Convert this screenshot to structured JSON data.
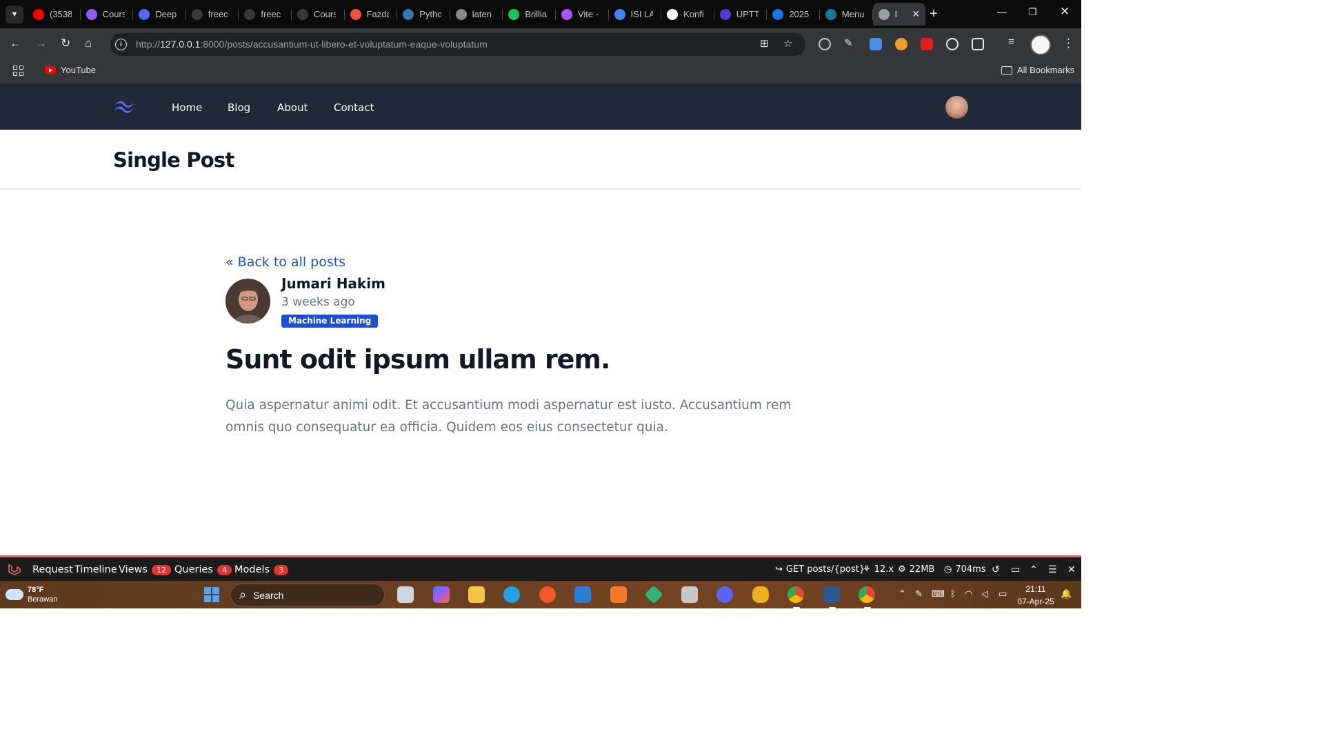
{
  "browser": {
    "tabs": [
      {
        "title": "(3538",
        "icon": "youtube-icon",
        "color": "#ff0000"
      },
      {
        "title": "Cours",
        "icon": "course-icon",
        "color": "#8b5cf6"
      },
      {
        "title": "Deep",
        "icon": "deepseek-icon",
        "color": "#4d6bfe"
      },
      {
        "title": "freec",
        "icon": "freecodecamp-icon",
        "color": "#3a3a3a"
      },
      {
        "title": "freec",
        "icon": "freecodecamp-icon",
        "color": "#3a3a3a"
      },
      {
        "title": "Cours",
        "icon": "course-icon",
        "color": "#3a3a3a"
      },
      {
        "title": "Fazda",
        "icon": "laravel-icon",
        "color": "#f05340"
      },
      {
        "title": "Pytho",
        "icon": "python-icon",
        "color": "#3776ab"
      },
      {
        "title": "laten",
        "icon": "globe-icon",
        "color": "#888888"
      },
      {
        "title": "Brillia",
        "icon": "brilliant-icon",
        "color": "#1fbf5b"
      },
      {
        "title": "Vite -",
        "icon": "vite-icon",
        "color": "#a855f7"
      },
      {
        "title": "ISI LA",
        "icon": "docs-icon",
        "color": "#4285f4"
      },
      {
        "title": "Konfi",
        "icon": "openai-icon",
        "color": "#ffffff"
      },
      {
        "title": "UPTT",
        "icon": "university-icon",
        "color": "#4c3ec9"
      },
      {
        "title": "2025",
        "icon": "person-icon",
        "color": "#1a73e8"
      },
      {
        "title": "Menu",
        "icon": "wordpress-icon",
        "color": "#21759b"
      },
      {
        "title": "I",
        "icon": "globe-icon",
        "color": "#9aa0a6",
        "active": true
      }
    ],
    "url_host": "127.0.0.1",
    "url_scheme": "http://",
    "url_rest": ":8000/posts/accusantium-ut-libero-et-voluptatum-eaque-voluptatum",
    "bookmarks": [
      {
        "label": "YouTube"
      }
    ],
    "all_bookmarks": "All Bookmarks"
  },
  "site": {
    "nav": [
      {
        "label": "Home"
      },
      {
        "label": "Blog"
      },
      {
        "label": "About"
      },
      {
        "label": "Contact"
      }
    ],
    "page_title": "Single Post"
  },
  "post": {
    "back_link": "« Back to all posts",
    "author": "Jumari Hakim",
    "time": "3 weeks ago",
    "category": "Machine Learning",
    "title": "Sunt odit ipsum ullam rem.",
    "body": "Quia aspernatur animi odit. Et accusantium modi aspernatur est iusto. Accusantium rem omnis quo consequatur ea officia. Quidem eos eius consectetur quia."
  },
  "debugbar": {
    "items": [
      {
        "label": "Request"
      },
      {
        "label": "Timeline"
      },
      {
        "label": "Views",
        "count": "12"
      },
      {
        "label": "Queries",
        "count": "4"
      },
      {
        "label": "Models",
        "count": "3"
      }
    ],
    "route": "GET posts/{post}",
    "version": "12.x",
    "memory": "22MB",
    "time": "704ms"
  },
  "taskbar": {
    "temp": "78°F",
    "weather": "Berawan",
    "search": "Search",
    "time": "21:11",
    "date": "07-Apr-25"
  },
  "colors": {
    "nav_bg": "#1f2937",
    "accent_blue": "#1d4ed8",
    "debug_red": "#e3342f"
  }
}
